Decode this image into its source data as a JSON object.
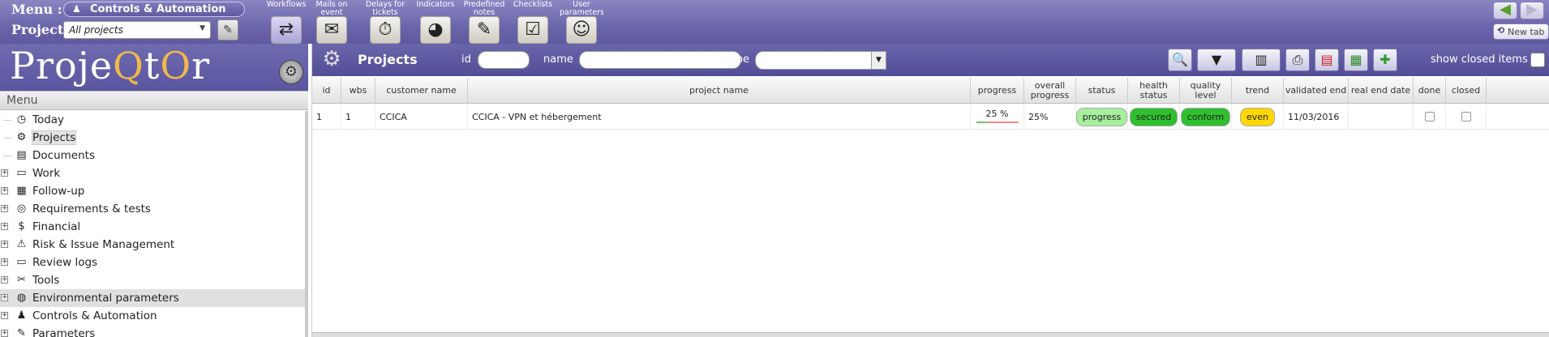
{
  "top": {
    "menu_label": "Menu :",
    "menu_value": "Controls & Automation",
    "project_label": "Project :",
    "project_value": "All projects",
    "tools": [
      {
        "label": "Workflows",
        "icon": "workflow-icon",
        "glyph": "⇄"
      },
      {
        "label": "Mails on event",
        "icon": "mail-icon",
        "glyph": "✉"
      },
      {
        "label": "Delays for tickets",
        "icon": "clock-icon",
        "glyph": "⏱"
      },
      {
        "label": "Indicators",
        "icon": "pie-chart-icon",
        "glyph": "◕"
      },
      {
        "label": "Predefined notes",
        "icon": "note-icon",
        "glyph": "✎"
      },
      {
        "label": "Checklists",
        "icon": "checklist-icon",
        "glyph": "☑"
      },
      {
        "label": "User parameters",
        "icon": "user-icon",
        "glyph": "☺"
      }
    ],
    "new_tab_label": "New tab"
  },
  "logo": {
    "part1": "Proje",
    "part2": "Q",
    "part3": "t",
    "part4": "O",
    "part5": "r"
  },
  "menu": {
    "header": "Menu",
    "items": [
      {
        "label": "Today",
        "icon": "clock-icon",
        "glyph": "◷",
        "expandable": false
      },
      {
        "label": "Projects",
        "icon": "gear-icon",
        "glyph": "⚙",
        "expandable": false,
        "active": true
      },
      {
        "label": "Documents",
        "icon": "document-icon",
        "glyph": "▤",
        "expandable": false
      },
      {
        "label": "Work",
        "icon": "computer-icon",
        "glyph": "▭",
        "expandable": true
      },
      {
        "label": "Follow-up",
        "icon": "calendar-icon",
        "glyph": "▦",
        "expandable": true
      },
      {
        "label": "Requirements & tests",
        "icon": "target-icon",
        "glyph": "◎",
        "expandable": true
      },
      {
        "label": "Financial",
        "icon": "money-bag-icon",
        "glyph": "$",
        "expandable": true
      },
      {
        "label": "Risk & Issue Management",
        "icon": "warning-icon",
        "glyph": "⚠",
        "expandable": true
      },
      {
        "label": "Review logs",
        "icon": "book-icon",
        "glyph": "▭",
        "expandable": true
      },
      {
        "label": "Tools",
        "icon": "tools-icon",
        "glyph": "✂",
        "expandable": true
      },
      {
        "label": "Environmental parameters",
        "icon": "globe-icon",
        "glyph": "◍",
        "expandable": true,
        "hover": true
      },
      {
        "label": "Controls & Automation",
        "icon": "robot-icon",
        "glyph": "♟",
        "expandable": true
      },
      {
        "label": "Parameters",
        "icon": "wrench-icon",
        "glyph": "✎",
        "expandable": true
      }
    ]
  },
  "list": {
    "title": "Projects",
    "filter_id_label": "id",
    "filter_name_label": "name",
    "filter_type_label": "type",
    "show_closed_label": "show closed items",
    "columns": [
      "id",
      "wbs",
      "customer name",
      "project name",
      "progress",
      "overall progress",
      "status",
      "health status",
      "quality level",
      "trend",
      "validated end",
      "real end date",
      "done",
      "closed"
    ],
    "rows": [
      {
        "id": "1",
        "wbs": "1",
        "customer": "CCICA",
        "project": "CCICA - VPN et hébergement",
        "progress_text": "25 %",
        "progress_value": 25,
        "overall": "25%",
        "status": "progress",
        "health": "secured",
        "quality": "conform",
        "trend": "even",
        "validated_end": "11/03/2016",
        "real_end": "",
        "done": false,
        "closed": false
      }
    ]
  },
  "colors": {
    "status_progress": "#a6ef9c",
    "health_secured": "#2fc02f",
    "quality_conform": "#2fc02f",
    "trend_even": "#ffd700",
    "header_purple": "#5e59a0"
  }
}
